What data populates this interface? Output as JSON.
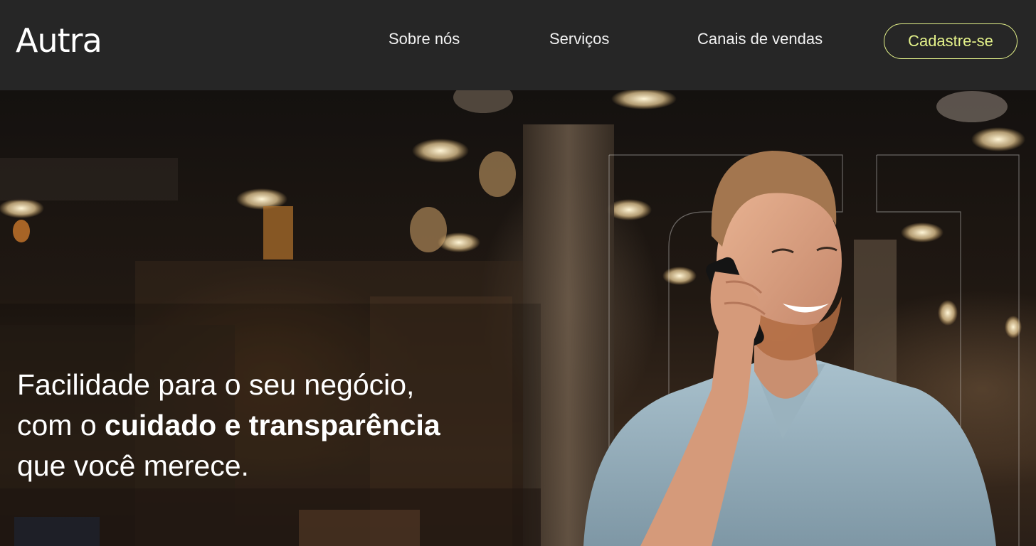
{
  "brand": {
    "logo_text": "Autra"
  },
  "nav": {
    "items": [
      {
        "label": "Sobre nós"
      },
      {
        "label": "Serviços"
      },
      {
        "label": "Canais de vendas"
      }
    ],
    "cta_label": "Cadastre-se"
  },
  "hero": {
    "headline_line1": "Facilidade para o seu negócio,",
    "headline_line2_prefix": "com o ",
    "headline_line2_bold": "cuidado e transparência",
    "headline_line3": "que você merece."
  },
  "colors": {
    "navbar_bg": "#262626",
    "accent": "#e4f28a",
    "text": "#ffffff"
  }
}
